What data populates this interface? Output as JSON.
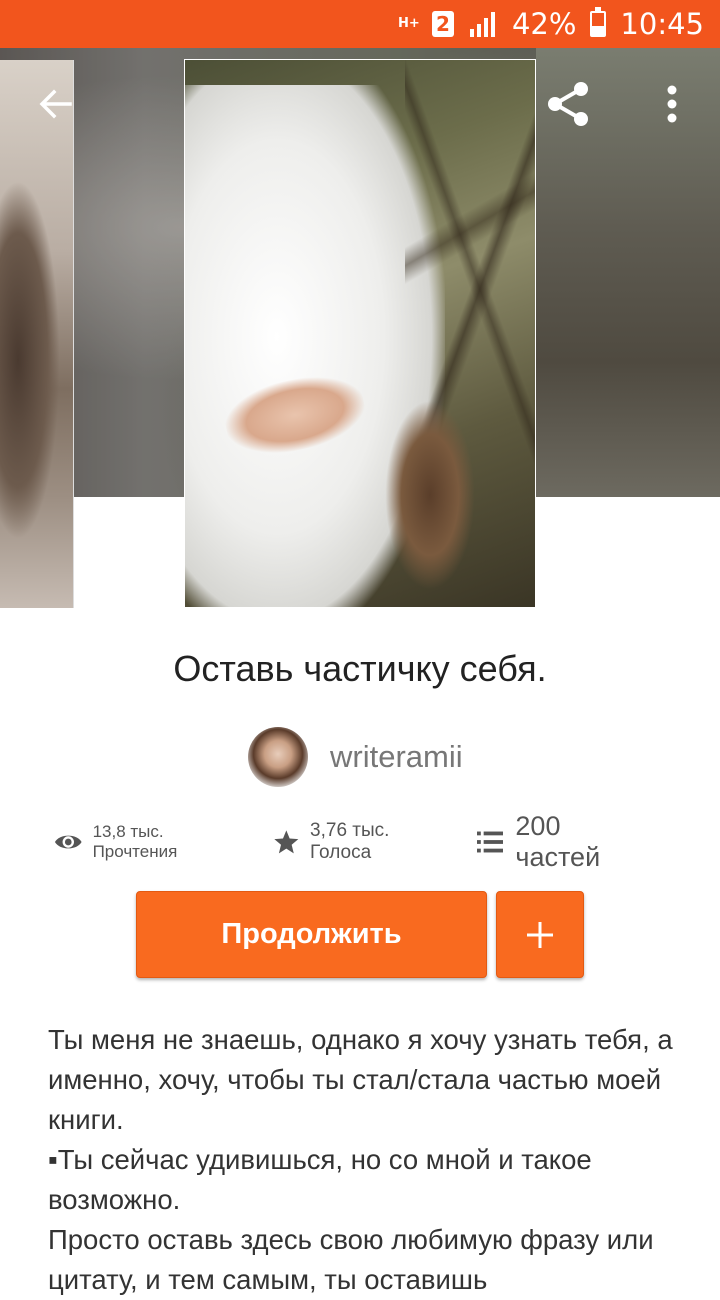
{
  "status_bar": {
    "network": "H+",
    "sim": "2",
    "battery_percent": "42%",
    "battery_level": 0.42,
    "time": "10:45"
  },
  "header": {
    "icons": [
      "back-arrow-icon",
      "share-icon",
      "more-vert-icon"
    ]
  },
  "story": {
    "title": "Оставь частичку себя.",
    "author": "writeramii"
  },
  "stats": {
    "reads": "13,8 тыс. Прочтения",
    "votes": "3,76 тыс. Голоса",
    "parts": "200 частей"
  },
  "actions": {
    "continue_label": "Продолжить",
    "add_label": "+"
  },
  "description": {
    "lines": [
      "Ты меня не знаешь, однако я хочу узнать тебя, а именно, хочу, чтобы ты стал/стала частью моей книги.",
      "▪Ты сейчас удивишься, но со мной и такое возможно.",
      "Просто оставь здесь свою любимую фразу или цитату, и тем самым, ты оставишь"
    ]
  },
  "colors": {
    "accent": "#f96a1f",
    "status_bar": "#f2551d",
    "title_text": "#222222",
    "muted_text": "#777777"
  }
}
